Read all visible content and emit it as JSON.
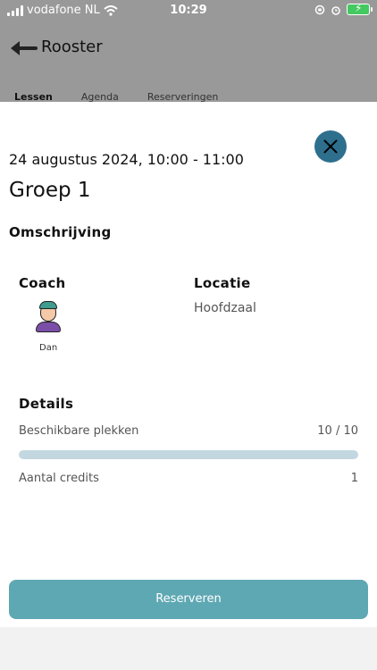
{
  "status_bar": {
    "carrier": "vodafone NL",
    "time": "10:29",
    "icons": [
      "signal-icon",
      "wifi-icon",
      "orientation-lock-icon",
      "alarm-icon",
      "battery-charging-icon"
    ]
  },
  "app_bar": {
    "title": "Rooster",
    "tabs": [
      "Lessen",
      "Agenda",
      "Reserveringen"
    ]
  },
  "lesson": {
    "datetime": "24 augustus 2024, 10:00 - 11:00",
    "title": "Groep 1",
    "description_heading": "Omschrijving",
    "coach_heading": "Coach",
    "coach_name": "Dan",
    "location_heading": "Locatie",
    "location": "Hoofdzaal",
    "details_heading": "Details",
    "available_spots_label": "Beschikbare plekken",
    "available_spots_value": "10 / 10",
    "available_spots_fraction": 1.0,
    "credits_label": "Aantal credits",
    "credits_value": "1",
    "reserve_button": "Reserveren"
  },
  "colors": {
    "close_button": "#2e6f8e",
    "reserve_button": "#5ea8b3",
    "progress_track": "#dfe8ee",
    "progress_fill": "#c3d7e0",
    "overlay": "#999999"
  }
}
